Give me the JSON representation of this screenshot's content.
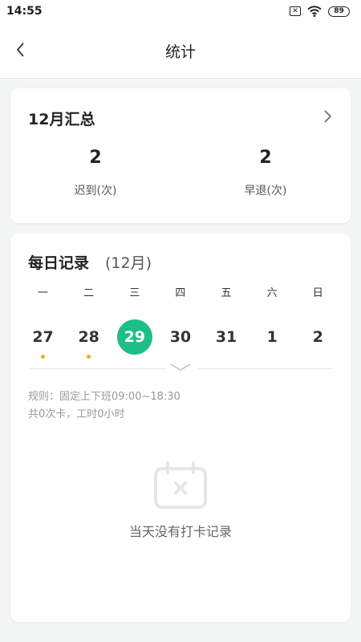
{
  "status_bar": {
    "time": "14:55",
    "sim_icon": "sim-x-icon",
    "wifi_icon": "wifi-icon",
    "battery": "89"
  },
  "header": {
    "title": "统计",
    "back_icon": "chevron-left-icon"
  },
  "summary": {
    "title": "12月汇总",
    "stats": [
      {
        "value": "2",
        "label": "迟到(次)"
      },
      {
        "value": "2",
        "label": "早退(次)"
      }
    ]
  },
  "daily": {
    "title": "每日记录",
    "month": "(12月)",
    "weekdays": [
      "一",
      "二",
      "三",
      "四",
      "五",
      "六",
      "日"
    ],
    "dates": [
      {
        "day": "27",
        "selected": false,
        "marker": true
      },
      {
        "day": "28",
        "selected": false,
        "marker": true
      },
      {
        "day": "29",
        "selected": true,
        "marker": false
      },
      {
        "day": "30",
        "selected": false,
        "marker": false
      },
      {
        "day": "31",
        "selected": false,
        "marker": false
      },
      {
        "day": "1",
        "selected": false,
        "marker": false
      },
      {
        "day": "2",
        "selected": false,
        "marker": false
      }
    ],
    "rule": "规则：固定上下班09:00~18:30",
    "summary_line": "共0次卡，工时0小时",
    "empty_text": "当天没有打卡记录"
  },
  "colors": {
    "accent": "#1dbf85",
    "marker": "#f5a623",
    "background": "#f4f5f5"
  }
}
